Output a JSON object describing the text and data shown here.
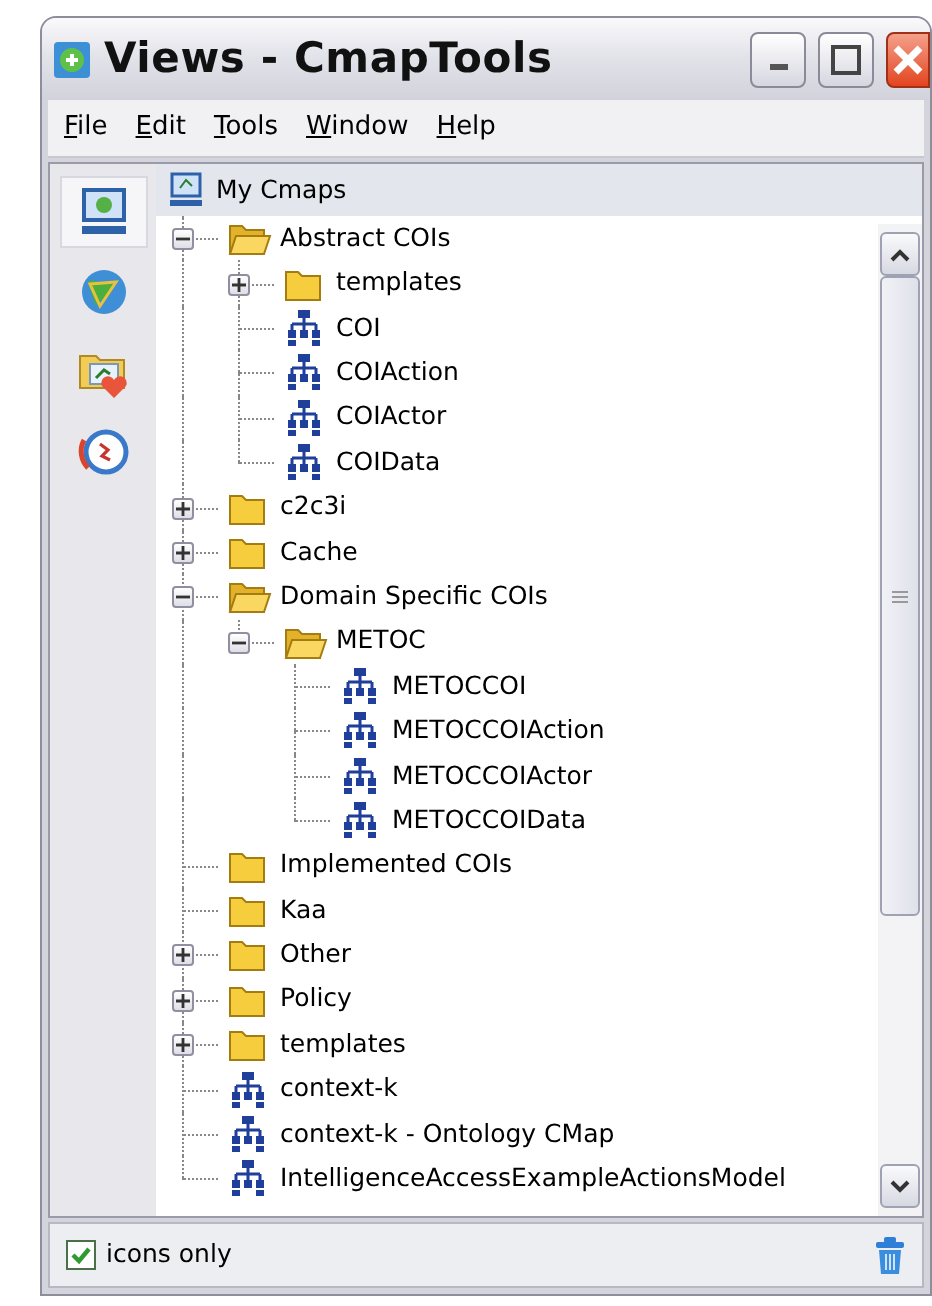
{
  "window": {
    "title": "Views - CmapTools"
  },
  "menu": [
    "File",
    "Edit",
    "Tools",
    "Window",
    "Help"
  ],
  "sidebar": {
    "items": [
      {
        "kind": "monitor",
        "selected": true
      },
      {
        "kind": "globe",
        "selected": false
      },
      {
        "kind": "favorites",
        "selected": false
      },
      {
        "kind": "history",
        "selected": false
      }
    ]
  },
  "tree": {
    "header": "My Cmaps",
    "items": [
      {
        "kind": "folder",
        "label": "Abstract COIs",
        "expanded": true,
        "children": [
          {
            "kind": "folder",
            "label": "templates",
            "expanded": false
          },
          {
            "kind": "cmap",
            "label": "COI"
          },
          {
            "kind": "cmap",
            "label": "COIAction"
          },
          {
            "kind": "cmap",
            "label": "COIActor"
          },
          {
            "kind": "cmap",
            "label": "COIData"
          }
        ]
      },
      {
        "kind": "folder",
        "label": "c2c3i",
        "expanded": false
      },
      {
        "kind": "folder",
        "label": "Cache",
        "expanded": false
      },
      {
        "kind": "folder",
        "label": "Domain Specific COIs",
        "expanded": true,
        "children": [
          {
            "kind": "folder",
            "label": "METOC",
            "expanded": true,
            "children": [
              {
                "kind": "cmap",
                "label": "METOCCOI"
              },
              {
                "kind": "cmap",
                "label": "METOCCOIAction"
              },
              {
                "kind": "cmap",
                "label": "METOCCOIActor"
              },
              {
                "kind": "cmap",
                "label": "METOCCOIData"
              }
            ]
          }
        ]
      },
      {
        "kind": "folder",
        "label": "Implemented COIs"
      },
      {
        "kind": "folder",
        "label": "Kaa"
      },
      {
        "kind": "folder",
        "label": "Other",
        "expanded": false
      },
      {
        "kind": "folder",
        "label": "Policy",
        "expanded": false
      },
      {
        "kind": "folder",
        "label": "templates",
        "expanded": false
      },
      {
        "kind": "cmap",
        "label": "context-k"
      },
      {
        "kind": "cmap",
        "label": "context-k - Ontology CMap"
      },
      {
        "kind": "cmap",
        "label": "IntelligenceAccessExampleActionsModel"
      }
    ]
  },
  "status_bar": {
    "checkbox": {
      "label": "icons only",
      "checked": true
    }
  }
}
